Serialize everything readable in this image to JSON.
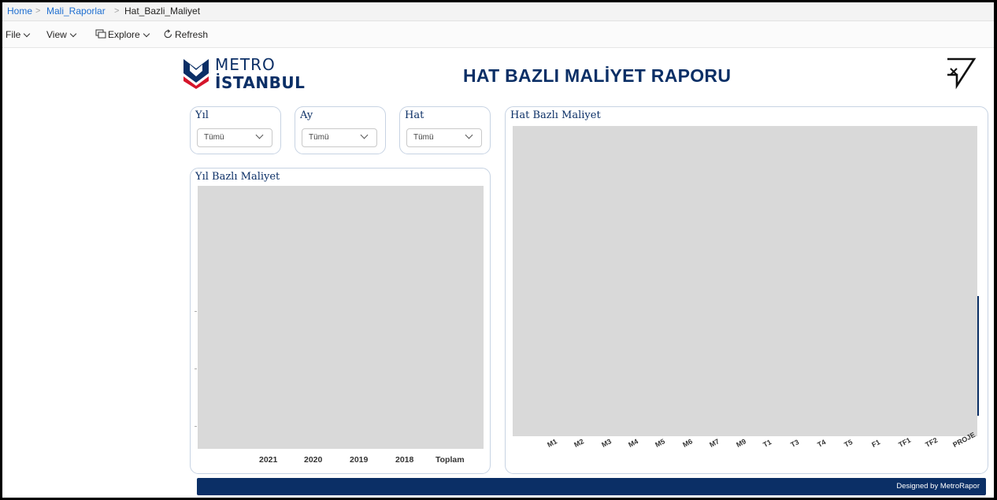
{
  "breadcrumb": {
    "home": "Home",
    "folder": "Mali_Raporlar",
    "current": "Hat_Bazli_Maliyet",
    "separator": ">"
  },
  "toolbar": {
    "file": "File",
    "view": "View",
    "explore": "Explore",
    "refresh": "Refresh"
  },
  "report": {
    "logo_top": "METRO",
    "logo_bottom": "İSTANBUL",
    "title": "HAT BAZLI MALİYET RAPORU",
    "footer": "Designed by MetroRapor"
  },
  "slicers": {
    "year": {
      "label": "Yıl",
      "value": "Tümü"
    },
    "month": {
      "label": "Ay",
      "value": "Tümü"
    },
    "line": {
      "label": "Hat",
      "value": "Tümü"
    }
  },
  "year_chart": {
    "title": "Yıl Bazlı Maliyet",
    "categories": [
      "2021",
      "2020",
      "2019",
      "2018",
      "Toplam"
    ]
  },
  "line_chart": {
    "title": "Hat Bazlı Maliyet",
    "categories": [
      "M1",
      "M2",
      "M3",
      "M4",
      "M5",
      "M6",
      "M7",
      "M9",
      "T1",
      "T3",
      "T4",
      "T5",
      "F1",
      "TF1",
      "TF2",
      "PROJE"
    ]
  },
  "colors": {
    "brand_navy": "#0b2f66",
    "brand_red": "#d5152b",
    "placeholder_gray": "#d9d9d9"
  }
}
